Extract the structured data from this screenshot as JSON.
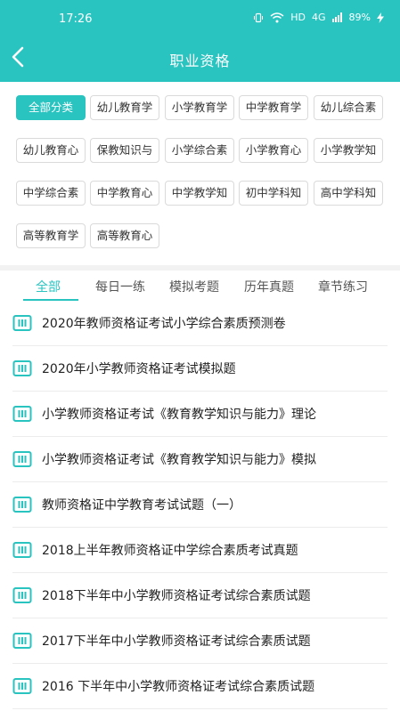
{
  "status": {
    "time": "17:26",
    "network": "HD",
    "signal": "4G",
    "battery": "89%"
  },
  "header": {
    "title": "职业资格"
  },
  "categories": [
    {
      "label": "全部分类",
      "active": true
    },
    {
      "label": "幼儿教育学"
    },
    {
      "label": "小学教育学"
    },
    {
      "label": "中学教育学"
    },
    {
      "label": "幼儿综合素"
    },
    {
      "label": "幼儿教育心"
    },
    {
      "label": "保教知识与"
    },
    {
      "label": "小学综合素"
    },
    {
      "label": "小学教育心"
    },
    {
      "label": "小学教学知"
    },
    {
      "label": "中学综合素"
    },
    {
      "label": "中学教育心"
    },
    {
      "label": "中学教学知"
    },
    {
      "label": "初中学科知"
    },
    {
      "label": "高中学科知"
    },
    {
      "label": "高等教育学"
    },
    {
      "label": "高等教育心"
    }
  ],
  "tabs": [
    {
      "label": "全部",
      "active": true
    },
    {
      "label": "每日一练"
    },
    {
      "label": "模拟考题"
    },
    {
      "label": "历年真题"
    },
    {
      "label": "章节练习"
    }
  ],
  "papers": [
    {
      "title": "2020年教师资格证考试小学综合素质预测卷"
    },
    {
      "title": "2020年小学教师资格证考试模拟题"
    },
    {
      "title": "小学教师资格证考试《教育教学知识与能力》理论"
    },
    {
      "title": "小学教师资格证考试《教育教学知识与能力》模拟"
    },
    {
      "title": "教师资格证中学教育考试试题（一）"
    },
    {
      "title": "2018上半年教师资格证中学综合素质考试真题"
    },
    {
      "title": "2018下半年中小学教师资格证考试综合素质试题"
    },
    {
      "title": "2017下半年中小学教师资格证考试综合素质试题"
    },
    {
      "title": "2016 下半年中小学教师资格证考试综合素质试题"
    }
  ],
  "colors": {
    "accent": "#29c3c0"
  }
}
